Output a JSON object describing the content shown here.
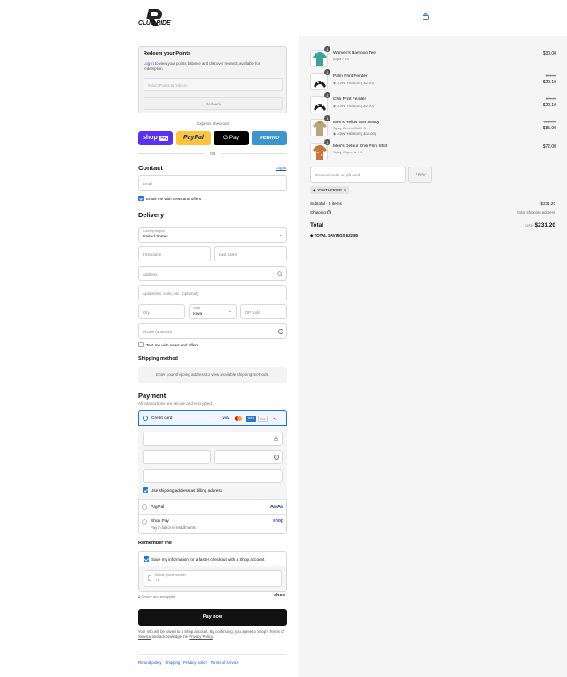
{
  "brand": {
    "logo_text": "CLUB RIDE"
  },
  "redeem": {
    "title": "Redeem your Points",
    "login_link": "Log in",
    "desc": "to view your points balance and discover rewards available for redemption.",
    "select_placeholder": "Select Points to redeem",
    "button": "Redeem"
  },
  "express": {
    "label": "Express checkout",
    "shop_pay": "shop",
    "shop_pay_badge": "Pay",
    "paypal": "PayPal",
    "gpay": "G Pay",
    "venmo": "venmo",
    "or": "OR"
  },
  "contact": {
    "title": "Contact",
    "login": "Log in",
    "email_placeholder": "Email",
    "email_opt": "Email me with news and offers"
  },
  "delivery": {
    "title": "Delivery",
    "country_label": "Country/Region",
    "country_value": "United States",
    "first_name": "First name",
    "last_name": "Last name",
    "address": "Address",
    "apartment": "Apartment, suite, etc. (optional)",
    "city": "City",
    "state_label": "State",
    "state_value": "Iowa",
    "zip": "ZIP code",
    "phone": "Phone (optional)",
    "text_opt": "Text me with news and offers"
  },
  "shipping": {
    "title": "Shipping method",
    "placeholder": "Enter your shipping address to view available shipping methods."
  },
  "payment": {
    "title": "Payment",
    "subtitle": "All transactions are secure and encrypted.",
    "credit_card": "Credit card",
    "card_brands": [
      "VISA",
      "MC",
      "AMEX",
      "DISC",
      "+4"
    ],
    "billing_same": "Use shipping address as billing address",
    "paypal": "PayPal",
    "paypal_logo": "PayPal",
    "shop_pay": "Shop Pay",
    "shop_pay_sub": "Pay in full or in installments",
    "shop_logo": "shop"
  },
  "remember": {
    "title": "Remember me",
    "save_info": "Save my information for a faster checkout with a Shop account",
    "mobile_label": "Mobile phone number",
    "mobile_prefix": "+1",
    "secure": "Secure and encrypted",
    "shop_logo": "shop"
  },
  "pay_button": "Pay now",
  "legal": {
    "text_1": "Your info will be saved to a Shop account. By continuing, you agree to Shop's",
    "terms": "Terms of Service",
    "text_2": "and acknowledge the",
    "privacy": "Privacy Policy",
    "text_3": "."
  },
  "footer_links": [
    "Refund policy",
    "Shipping",
    "Privacy policy",
    "Terms of service"
  ],
  "cart": {
    "items": [
      {
        "qty": "1",
        "name": "Women's Bamboo Tee",
        "variant": "Aqua / XS",
        "price": "$30.00",
        "color": "#3aa39a"
      },
      {
        "qty": "1",
        "name": "Palm Print Fender",
        "discount": "JOINTHERIDE (-$2.90)",
        "old_price": "$25.00",
        "new_price": "$22.10",
        "color": "#222"
      },
      {
        "qty": "1",
        "name": "Chili Print Fender",
        "discount": "JOINTHERIDE (-$2.90)",
        "old_price": "$25.00",
        "new_price": "$22.10",
        "color": "#222"
      },
      {
        "qty": "1",
        "name": "Men's Helios Sun Hoody",
        "variant": "Spicy Green Chili / S",
        "discount": "JOINTHERIDE (-$15.00)",
        "old_price": "$100.00",
        "new_price": "$85.00",
        "color": "#b9a77a"
      },
      {
        "qty": "1",
        "name": "Men's Detour Chili Print Shirt",
        "variant": "Spicy Cayenne / S",
        "price": "$72.00",
        "color": "#c7773a"
      }
    ],
    "discount_placeholder": "Discount code or gift card",
    "apply": "Apply",
    "code_tag": "JOINTHERIDE",
    "subtotal_label": "Subtotal · 5 items",
    "subtotal_value": "$231.20",
    "shipping_label": "Shipping",
    "shipping_value": "Enter shipping address",
    "total_label": "Total",
    "currency": "USD",
    "total_value": "$231.20",
    "savings_label": "TOTAL SAVINGS",
    "savings_value": "$22.80"
  },
  "colors": {
    "accent": "#1a73e8",
    "shop_purple": "#5a31f4",
    "paypal_yellow": "#ffc439",
    "venmo_blue": "#3d95ce"
  }
}
